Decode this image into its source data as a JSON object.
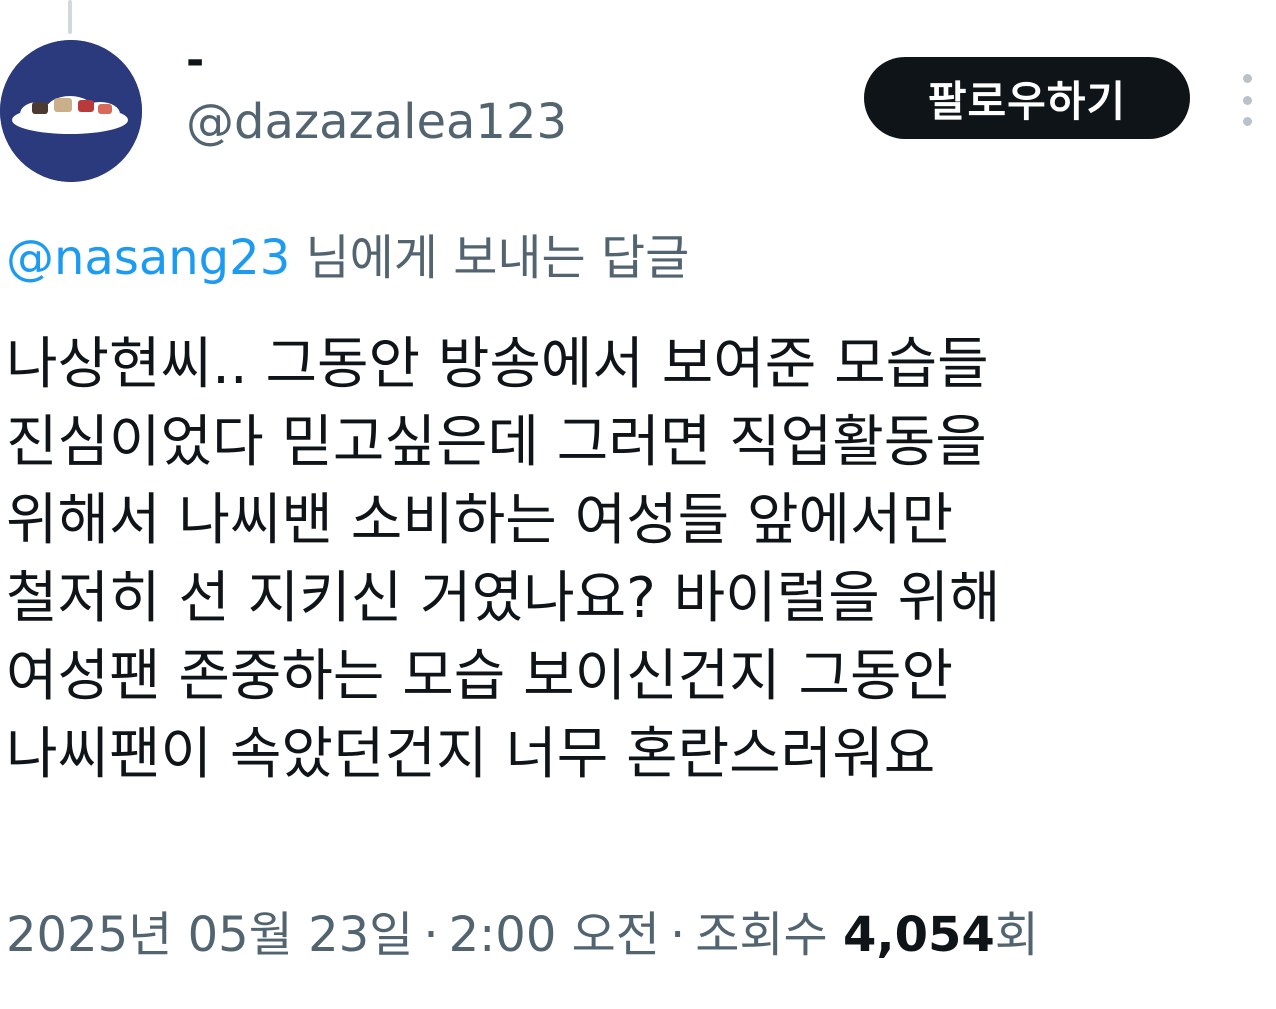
{
  "author": {
    "display_name": "-",
    "handle": "@dazazalea123"
  },
  "header": {
    "follow_label": "팔로우하기",
    "more_icon": "more-vertical-icon"
  },
  "reply": {
    "to_handle": "@nasang23",
    "suffix": " 님에게 보내는 답글"
  },
  "tweet": {
    "lines": [
      "나상현씨.. 그동안 방송에서 보여준 모습들",
      "진심이었다 믿고싶은데 그러면 직업활동을",
      "위해서 나씨밴 소비하는 여성들 앞에서만",
      "철저히 선 지키신 거였나요? 바이럴을 위해",
      "여성팬 존중하는 모습 보이신건지 그동안",
      "나씨팬이 속았던건지 너무 혼란스러워요"
    ]
  },
  "meta": {
    "date": "2025년 05월 23일",
    "time": "2:00 오전",
    "separator": "·",
    "views_label": "조회수",
    "views_count": "4,054",
    "views_suffix": "회"
  },
  "colors": {
    "text_primary": "#0f1419",
    "text_secondary": "#536471",
    "link": "#1d9bf0",
    "button_bg": "#0f1419",
    "avatar_bg": "#2a3a7c"
  }
}
